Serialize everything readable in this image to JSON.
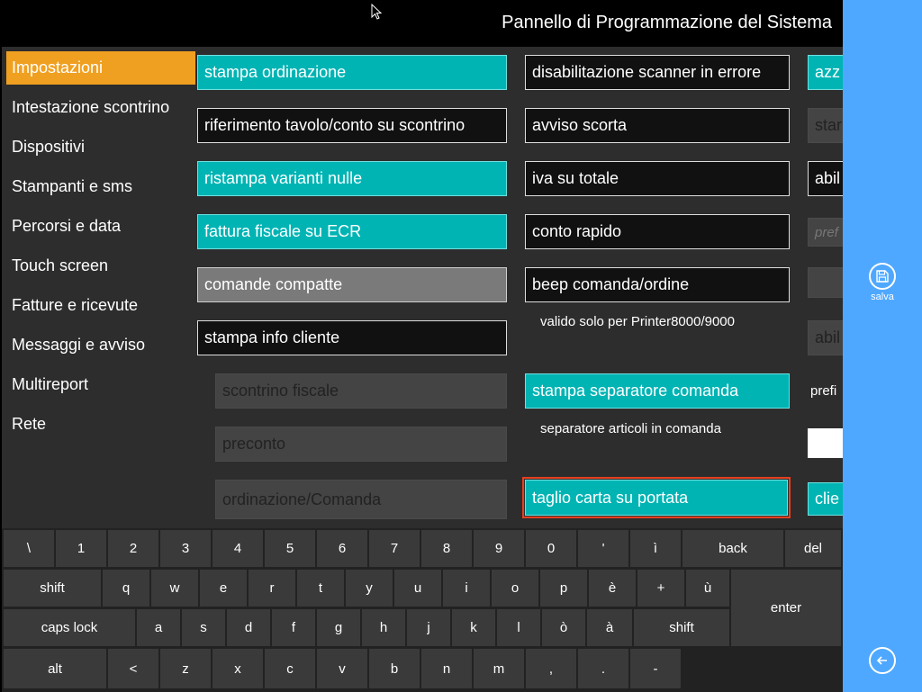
{
  "window": {
    "title": "Pannello di Programmazione del Sistema"
  },
  "sidebar": {
    "items": [
      {
        "label": "Impostazioni",
        "active": true
      },
      {
        "label": "Intestazione scontrino"
      },
      {
        "label": "Dispositivi"
      },
      {
        "label": "Stampanti e sms"
      },
      {
        "label": "Percorsi e data"
      },
      {
        "label": "Touch screen"
      },
      {
        "label": "Fatture e ricevute"
      },
      {
        "label": "Messaggi e avviso"
      },
      {
        "label": "Multireport"
      },
      {
        "label": "Rete"
      }
    ]
  },
  "options": {
    "col1": [
      {
        "label": "stampa ordinazione",
        "state": "teal"
      },
      {
        "label": "riferimento tavolo/conto su scontrino",
        "state": "dark"
      },
      {
        "label": "ristampa varianti nulle",
        "state": "teal"
      },
      {
        "label": "fattura fiscale su ECR",
        "state": "teal"
      },
      {
        "label": "comande compatte",
        "state": "gray"
      },
      {
        "label": "stampa info cliente",
        "state": "dark"
      },
      {
        "label": "scontrino fiscale",
        "state": "disabled"
      },
      {
        "label": "preconto",
        "state": "disabled"
      },
      {
        "label": "ordinazione/Comanda",
        "state": "disabled"
      }
    ],
    "col2": [
      {
        "label": "disabilitazione scanner in errore",
        "state": "dark"
      },
      {
        "label": "avviso scorta",
        "state": "dark"
      },
      {
        "label": "iva su totale",
        "state": "dark"
      },
      {
        "label": "conto rapido",
        "state": "dark"
      },
      {
        "label": "beep comanda/ordine",
        "state": "dark"
      },
      {
        "label": "stampa separatore comanda",
        "state": "teal"
      },
      {
        "label": "taglio carta su portata",
        "state": "teal"
      }
    ],
    "col2_notes": [
      "valido solo per Printer8000/9000",
      "separatore articoli in comanda"
    ],
    "col3": [
      {
        "label": "azz",
        "state": "teal"
      },
      {
        "label": "star",
        "state": "disabled"
      },
      {
        "label": "abil",
        "state": "dark"
      },
      {
        "label": "pref",
        "state": "disabled"
      },
      {
        "label": "",
        "state": "disabled"
      },
      {
        "label": "abil",
        "state": "disabled"
      },
      {
        "label": "prefi",
        "state": "text"
      },
      {
        "label": "",
        "state": "white"
      },
      {
        "label": "clie",
        "state": "teal"
      }
    ]
  },
  "keyboard": {
    "row1": [
      "\\",
      "1",
      "2",
      "3",
      "4",
      "5",
      "6",
      "7",
      "8",
      "9",
      "0",
      "'",
      "ì",
      "back",
      "del"
    ],
    "row2": [
      "shift",
      "q",
      "w",
      "e",
      "r",
      "t",
      "y",
      "u",
      "i",
      "o",
      "p",
      "è",
      "+",
      "ù"
    ],
    "row3": [
      "caps lock",
      "a",
      "s",
      "d",
      "f",
      "g",
      "h",
      "j",
      "k",
      "l",
      "ò",
      "à",
      "shift"
    ],
    "row4": [
      "alt",
      "<",
      "z",
      "x",
      "c",
      "v",
      "b",
      "n",
      "m",
      ",",
      ".",
      "-"
    ],
    "enter": "enter"
  },
  "right_panel": {
    "save_label": "salva"
  },
  "colors": {
    "accent": "#f0a020",
    "teal": "#00b4b4",
    "panel": "#4fa8ff"
  }
}
